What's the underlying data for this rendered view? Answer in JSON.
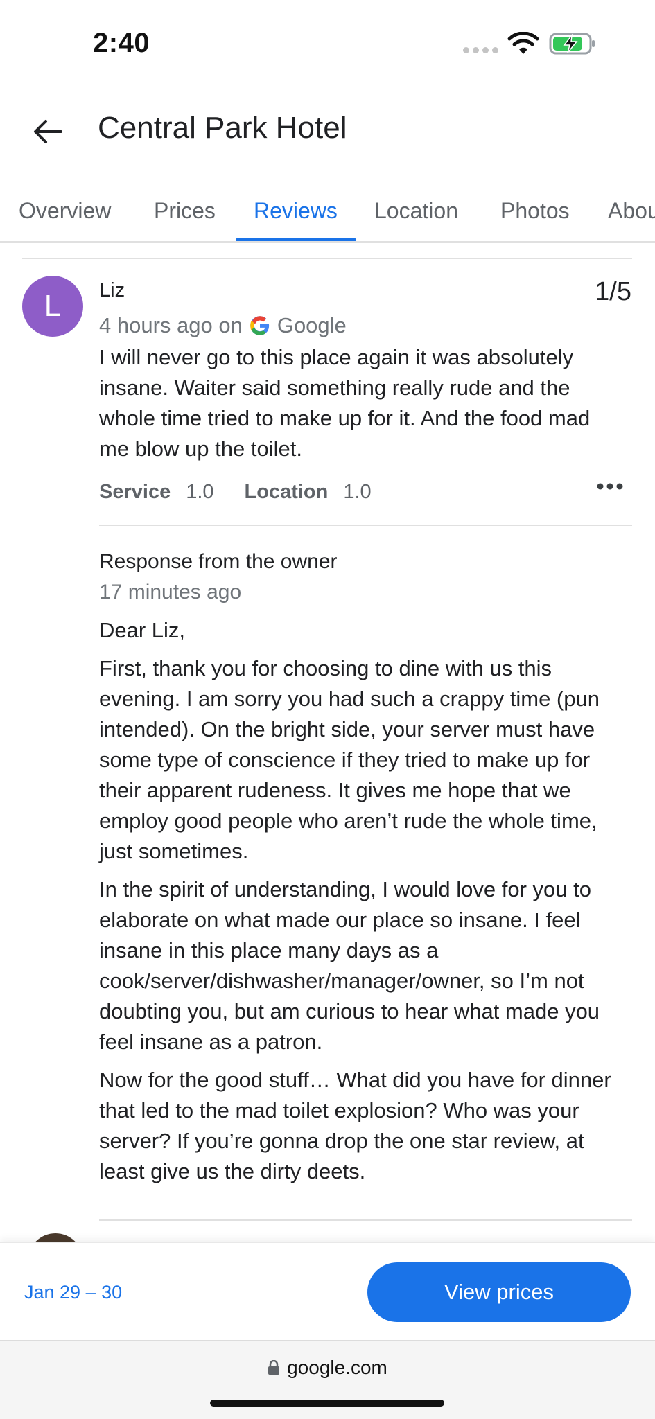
{
  "status": {
    "time": "2:40"
  },
  "header": {
    "title": "Central Park Hotel"
  },
  "tabs": [
    {
      "label": "Overview",
      "active": false
    },
    {
      "label": "Prices",
      "active": false
    },
    {
      "label": "Reviews",
      "active": true
    },
    {
      "label": "Location",
      "active": false
    },
    {
      "label": "Photos",
      "active": false
    },
    {
      "label": "About",
      "active": false
    }
  ],
  "review": {
    "avatar_letter": "L",
    "name": "Liz",
    "rating": "1/5",
    "time_prefix": "4 hours ago on",
    "source": "Google",
    "text": "I will never go to this place again it was absolutely insane. Waiter said something really rude and the whole time tried to make up for it. And the food mad me blow up the toilet.",
    "sub_ratings": [
      {
        "label": "Service",
        "value": "1.0"
      },
      {
        "label": "Location",
        "value": "1.0"
      }
    ]
  },
  "response": {
    "title": "Response from the owner",
    "time": "17 minutes ago",
    "paragraphs": [
      "Dear Liz,",
      "First, thank you for choosing to dine with us this evening. I am sorry you had such a crappy time (pun intended). On the bright side, your server must have some type of conscience if they tried to make up for their apparent rudeness. It gives me hope that we employ good people who aren’t rude the whole time, just sometimes.",
      "In the spirit of understanding, I would love for you to elaborate on what made our place so insane. I feel insane in this place many days as a cook/server/dishwasher/manager/owner, so I’m not doubting you, but am curious to hear what made you feel insane as a patron.",
      "Now for the good stuff… What did you have for dinner that led to the mad toilet explosion? Who was your server? If you’re gonna drop the one star review, at least give us the dirty deets."
    ]
  },
  "bottom_bar": {
    "date_range": "Jan 29 – 30",
    "cta_label": "View prices"
  },
  "browser": {
    "url": "google.com"
  },
  "colors": {
    "accent": "#1a73e8",
    "avatar": "#8e5dc8"
  }
}
